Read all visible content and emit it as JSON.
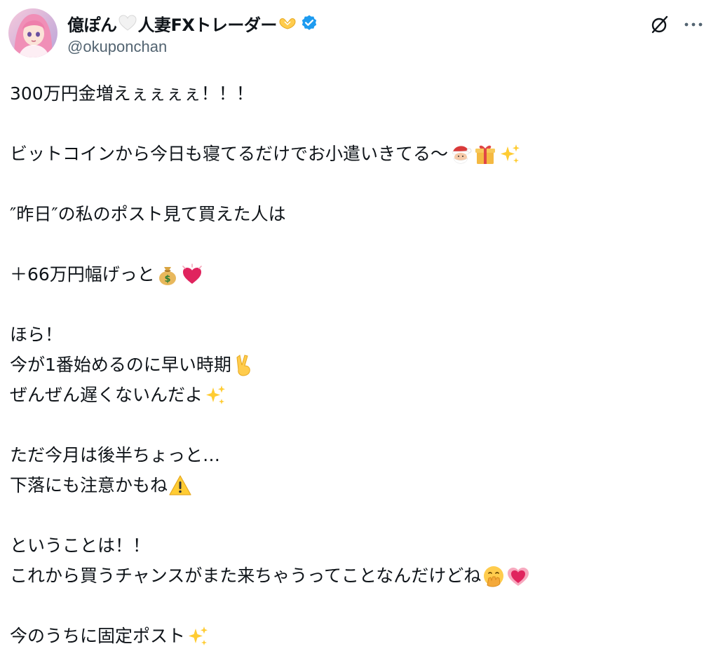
{
  "post": {
    "author": {
      "display_name_part1": "億ぽん",
      "display_name_part2": "人妻FXトレーダー",
      "handle": "@okuponchan",
      "verified": true
    },
    "header_icons": {
      "avatar": "avatar-image",
      "grok": "grok-icon",
      "more": "more-options-icon"
    },
    "lines": [
      "300万円金増えぇぇぇぇ！！！",
      "",
      "ビットコインから今日も寝てるだけでお小遣いきてる〜",
      "",
      "″昨日″の私のポスト見て買えた人は",
      "",
      "＋66万円幅げっと",
      "",
      "ほら！",
      "今が1番始めるのに早い時期",
      "ぜんぜん遅くないんだよ",
      "",
      "ただ今月は後半ちょっと…",
      "下落にも注意かもね",
      "",
      "ということは！！",
      "これから買うチャンスがまた来ちゃうってことなんだけどね",
      "",
      "今のうちに固定ポスト"
    ]
  },
  "colors": {
    "text": "#0f1419",
    "secondary_text": "#536471",
    "verified_badge": "#1d9bf0",
    "background": "#ffffff"
  }
}
